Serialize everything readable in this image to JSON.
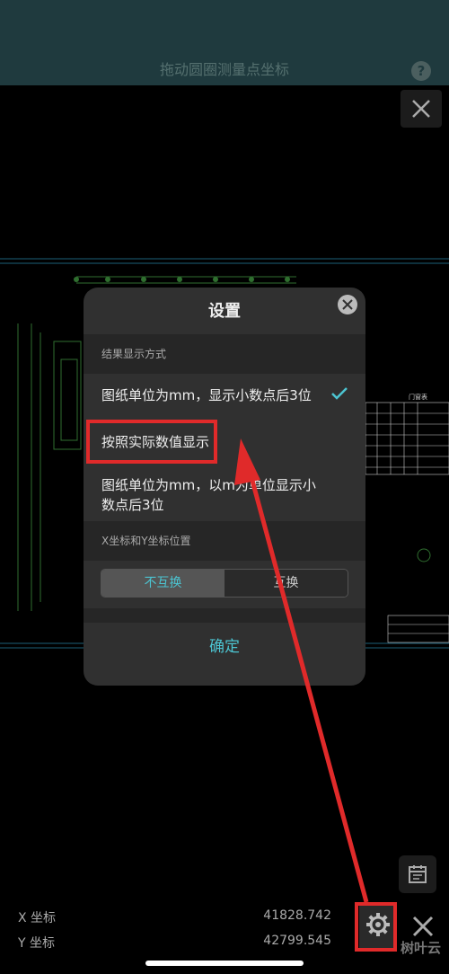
{
  "header": {
    "title": "拖动圆圈测量点坐标",
    "help_symbol": "?"
  },
  "dialog": {
    "title": "设置",
    "section1_label": "结果显示方式",
    "options": [
      {
        "line1": "图纸单位为mm，显示小数点后3位",
        "line2": "",
        "selected": true
      },
      {
        "line1": "按照实际数值显示",
        "line2": "",
        "selected": false
      },
      {
        "line1": "图纸单位为mm，以m为单位显示小",
        "line2": "数点后3位",
        "selected": false
      }
    ],
    "section2_label": "X坐标和Y坐标位置",
    "segment": {
      "left": "不互换",
      "right": "互换",
      "active": "left"
    },
    "confirm_label": "确定"
  },
  "coords": {
    "x_label": "X 坐标",
    "x_value": "41828.742",
    "y_label": "Y 坐标",
    "y_value": "42799.545"
  },
  "drawing_table_title": "门窗表",
  "watermark": "树叶云",
  "colors": {
    "accent": "#4cc4d1",
    "highlight": "#e02a2a",
    "header_bg": "#1f3a3e"
  },
  "icons": [
    "help-icon",
    "close-icon",
    "check-icon",
    "calendar-icon",
    "gear-icon"
  ]
}
